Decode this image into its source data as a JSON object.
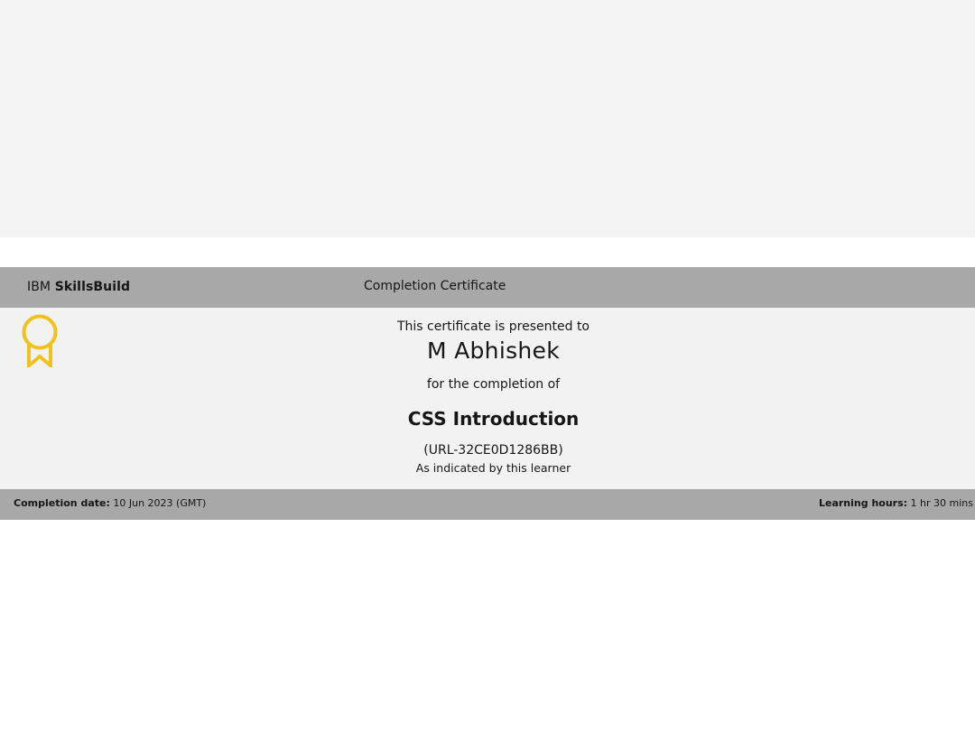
{
  "header": {
    "brand_prefix": "IBM",
    "brand_name": "SkillsBuild",
    "certificate_type": "Completion Certificate"
  },
  "certificate": {
    "presented_text": "This certificate is presented to",
    "learner_name": "M Abhishek",
    "completion_text": "for the completion of",
    "course_title": "CSS Introduction",
    "code": "(URL-32CE0D1286BB)",
    "attestation": "As indicated by this learner",
    "badge_icon": "award-ribbon-icon",
    "badge_color": "#f1c21b"
  },
  "footer": {
    "completion_date_label": "Completion date:",
    "completion_date_value": "10 Jun 2023 (GMT)",
    "learning_hours_label": "Learning hours:",
    "learning_hours_value": "1 hr 30 mins"
  },
  "colors": {
    "bar_gray": "#a8a8a8",
    "body_gray": "#f2f2f2",
    "top_band": "#f4f4f4"
  }
}
